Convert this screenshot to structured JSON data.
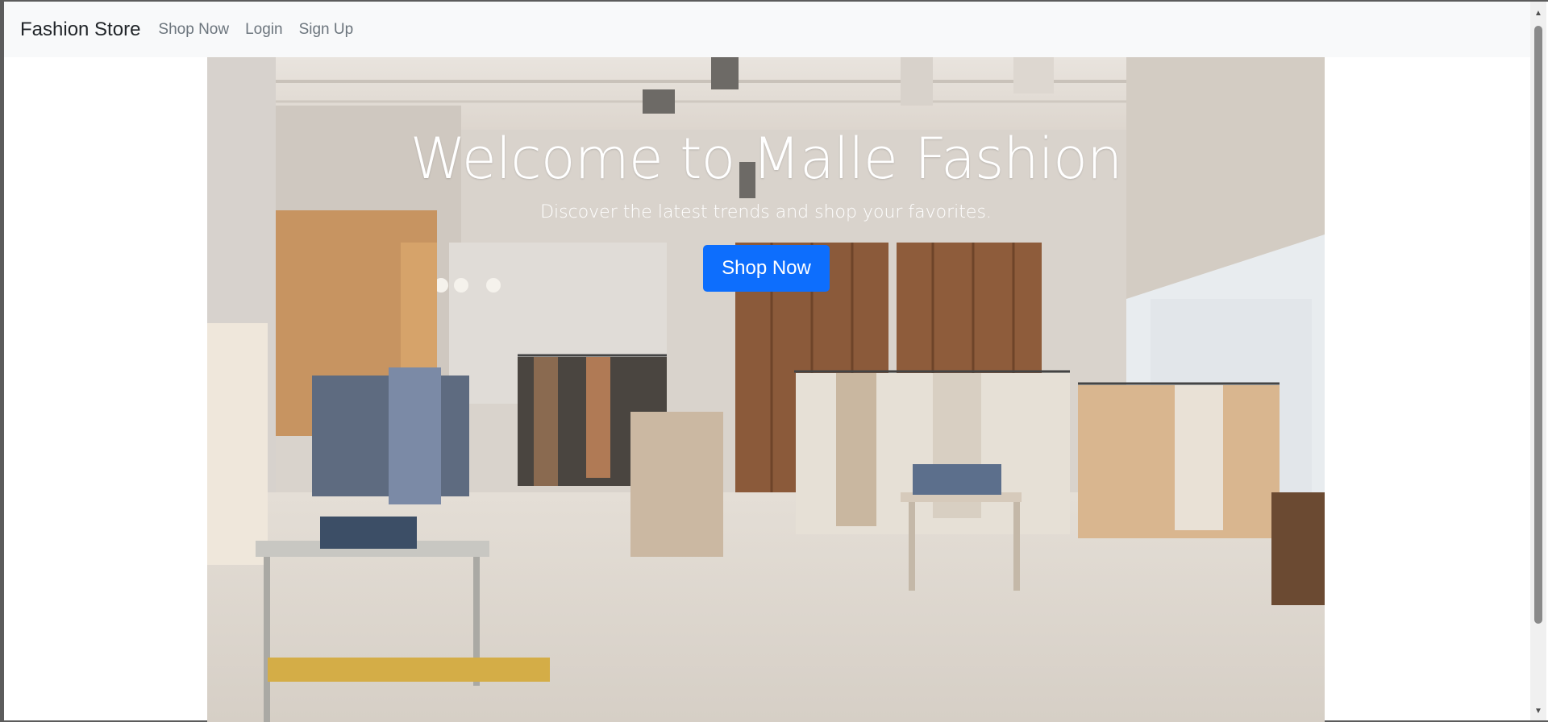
{
  "navbar": {
    "brand": "Fashion Store",
    "links": [
      "Shop Now",
      "Login",
      "Sign Up"
    ]
  },
  "hero": {
    "title": "Welcome to Malle Fashion",
    "subtitle": "Discover the latest trends and shop your favorites.",
    "button_label": "Shop Now",
    "image": "clothing-store-interior-photo"
  },
  "colors": {
    "navbar_bg": "#f8f9fa",
    "primary_button": "#0d6efd",
    "nav_link": "#6c757d",
    "brand": "#212529"
  },
  "icons": {
    "scroll_up": "scroll-up-arrow-icon",
    "scroll_down": "scroll-down-arrow-icon"
  }
}
